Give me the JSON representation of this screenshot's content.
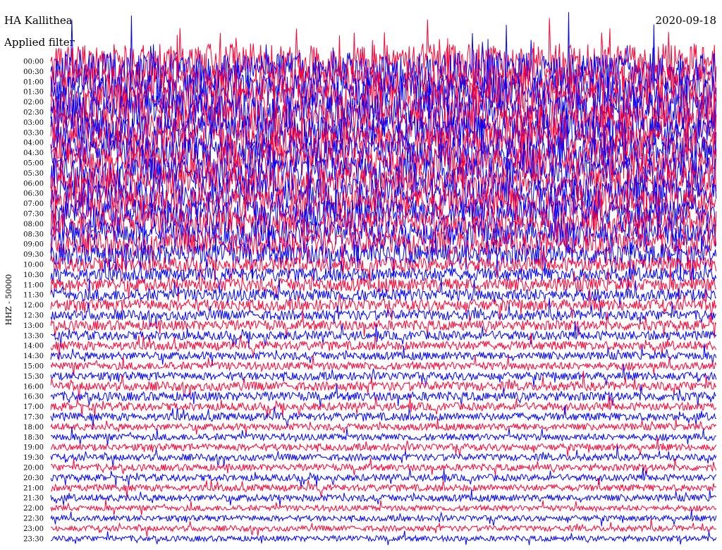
{
  "header": {
    "title": "HA Kallithea",
    "date": "2020-09-18",
    "filter_note": "Applied filter"
  },
  "chart_data": {
    "type": "line",
    "title": "HA Kallithea",
    "ylabel": "HHZ - 50000",
    "row_labels": [
      "00:00",
      "00:30",
      "01:00",
      "01:30",
      "02:00",
      "02:30",
      "03:00",
      "03:30",
      "04:00",
      "04:30",
      "05:00",
      "05:30",
      "06:00",
      "06:30",
      "07:00",
      "07:30",
      "08:00",
      "08:30",
      "09:00",
      "09:30",
      "10:00",
      "10:30",
      "11:00",
      "11:30",
      "12:00",
      "12:30",
      "13:00",
      "13:30",
      "14:00",
      "14:30",
      "15:00",
      "15:30",
      "16:00",
      "16:30",
      "17:00",
      "17:30",
      "18:00",
      "18:30",
      "19:00",
      "19:30",
      "20:00",
      "20:30",
      "21:00",
      "21:30",
      "22:00",
      "22:30",
      "23:00",
      "23:30"
    ],
    "row_colors": [
      "#ff0033",
      "#0000ff"
    ],
    "relative_amplitude": [
      3.2,
      3.4,
      3.0,
      3.1,
      3.3,
      3.2,
      3.1,
      3.0,
      2.9,
      2.9,
      2.8,
      2.8,
      2.7,
      2.6,
      2.6,
      2.5,
      2.4,
      2.3,
      2.1,
      1.9,
      1.3,
      1.2,
      1.2,
      1.1,
      1.0,
      0.9,
      0.9,
      0.8,
      0.8,
      0.7,
      0.7,
      0.7,
      0.8,
      0.8,
      0.7,
      0.7,
      0.6,
      0.6,
      0.6,
      0.6,
      0.6,
      0.6,
      0.6,
      0.6,
      0.5,
      0.5,
      0.5,
      0.5
    ],
    "grid": false
  }
}
